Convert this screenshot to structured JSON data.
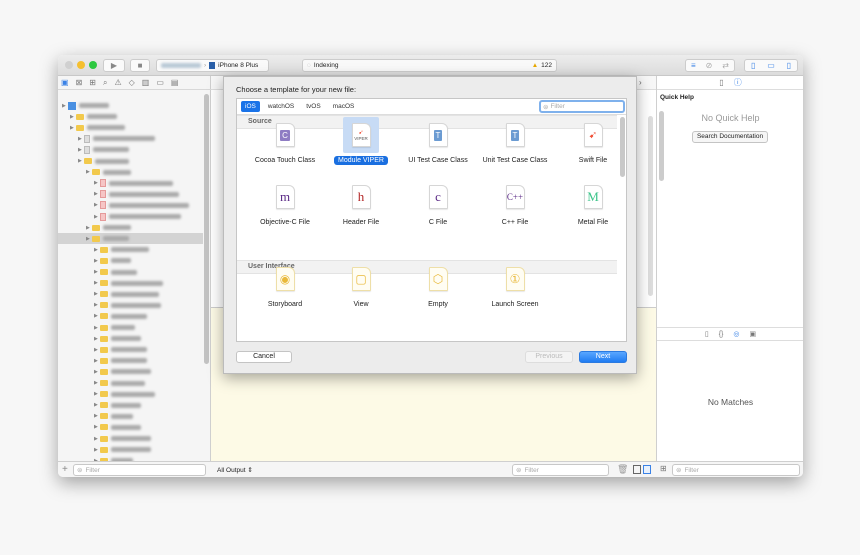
{
  "toolbar": {
    "device": "iPhone 8 Plus",
    "activity": "Indexing",
    "warning_count": "122"
  },
  "navigator": {
    "filter_placeholder": "Filter"
  },
  "dialog": {
    "title": "Choose a template for your new file:",
    "tabs": [
      {
        "label": "iOS",
        "selected": true
      },
      {
        "label": "watchOS"
      },
      {
        "label": "tvOS"
      },
      {
        "label": "macOS"
      }
    ],
    "filter_placeholder": "Filter",
    "sections": [
      {
        "title": "Source",
        "items": [
          {
            "label": "Cocoa Touch Class",
            "icon": "C",
            "color": "#8e7cc3"
          },
          {
            "label": "Module VIPER",
            "icon": "VIPER",
            "selected": true
          },
          {
            "label": "UI Test Case Class",
            "icon": "T",
            "color": "#6b9bd2"
          },
          {
            "label": "Unit Test Case Class",
            "icon": "T",
            "color": "#6b9bd2"
          },
          {
            "label": "Swift File",
            "icon": "swift",
            "color": "#f05138"
          },
          {
            "label": "Objective-C File",
            "icon": "m",
            "color": "#5b2a86"
          },
          {
            "label": "Header File",
            "icon": "h",
            "color": "#b22222"
          },
          {
            "label": "C File",
            "icon": "c",
            "color": "#5b2a86"
          },
          {
            "label": "C++ File",
            "icon": "C++",
            "color": "#5b2a86"
          },
          {
            "label": "Metal File",
            "icon": "M",
            "color": "#3cc48a"
          }
        ]
      },
      {
        "title": "User Interface",
        "items": [
          {
            "label": "Storyboard",
            "icon": "storyboard"
          },
          {
            "label": "View",
            "icon": "view"
          },
          {
            "label": "Empty",
            "icon": "cube"
          },
          {
            "label": "Launch Screen",
            "icon": "1"
          }
        ]
      }
    ],
    "cancel": "Cancel",
    "previous": "Previous",
    "next": "Next"
  },
  "debug": {
    "output_selector": "All Output ⇕",
    "filter_placeholder": "Filter"
  },
  "inspector": {
    "section": "Quick Help",
    "empty": "No Quick Help",
    "search_button": "Search Documentation"
  },
  "library": {
    "empty": "No Matches",
    "filter_placeholder": "Filter"
  },
  "colors": {
    "accent": "#1a73e8",
    "debug_bg": "#fdfae6"
  }
}
